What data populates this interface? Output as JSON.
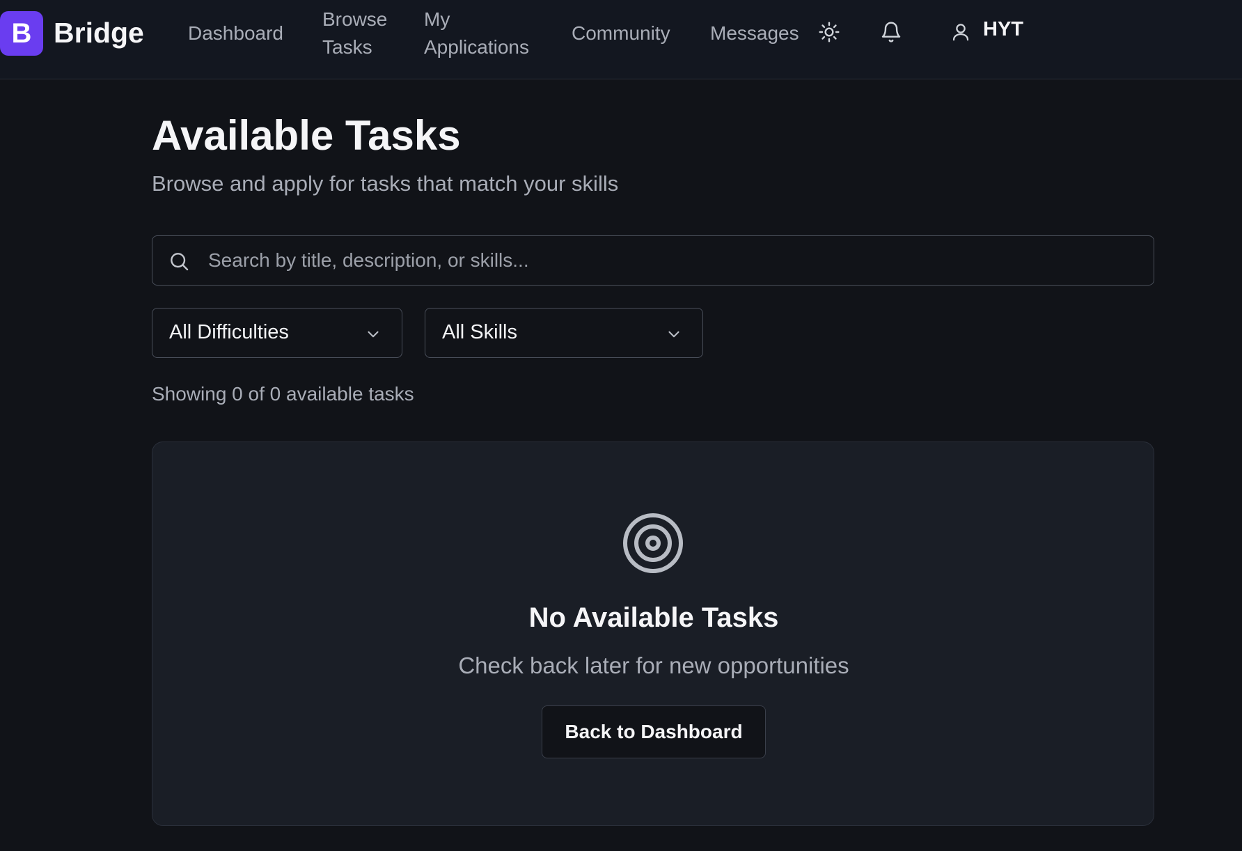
{
  "brand": {
    "logo_letter": "B",
    "name": "Bridge",
    "accent_color": "#6a3df0"
  },
  "nav": {
    "dashboard": "Dashboard",
    "browse_tasks_line1": "Browse",
    "browse_tasks_line2": "Tasks",
    "my_applications_line1": "My",
    "my_applications_line2": "Applications",
    "community": "Community",
    "messages": "Messages",
    "theme_icon": "sun-icon",
    "notifications_icon": "bell-icon",
    "user_icon": "user-icon",
    "user_name": "HYT"
  },
  "page": {
    "title": "Available Tasks",
    "subtitle": "Browse and apply for tasks that match your skills"
  },
  "search": {
    "icon": "search-icon",
    "placeholder": "Search by title, description, or skills...",
    "value": ""
  },
  "filters": {
    "difficulty": {
      "selected": "All Difficulties"
    },
    "skills": {
      "selected": "All Skills"
    }
  },
  "results": {
    "count_text": "Showing 0 of 0 available tasks"
  },
  "empty_state": {
    "icon": "target-icon",
    "title": "No Available Tasks",
    "message": "Check back later for new opportunities",
    "button_label": "Back to Dashboard"
  }
}
